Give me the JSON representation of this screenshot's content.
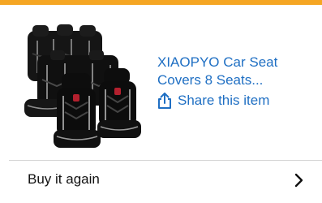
{
  "product": {
    "title": "XIAOPYO Car Seat Covers 8 Seats...",
    "image_icon": "car-seat-covers-product-image",
    "share_label": "Share this item",
    "share_icon": "share-icon"
  },
  "actions": {
    "buy_again_label": "Buy it again",
    "buy_again_icon": "chevron-right-icon"
  },
  "colors": {
    "accent_strip": "#f5a623",
    "link_blue": "#1f6fc3",
    "text": "#111111",
    "divider": "#d6d6d6"
  }
}
